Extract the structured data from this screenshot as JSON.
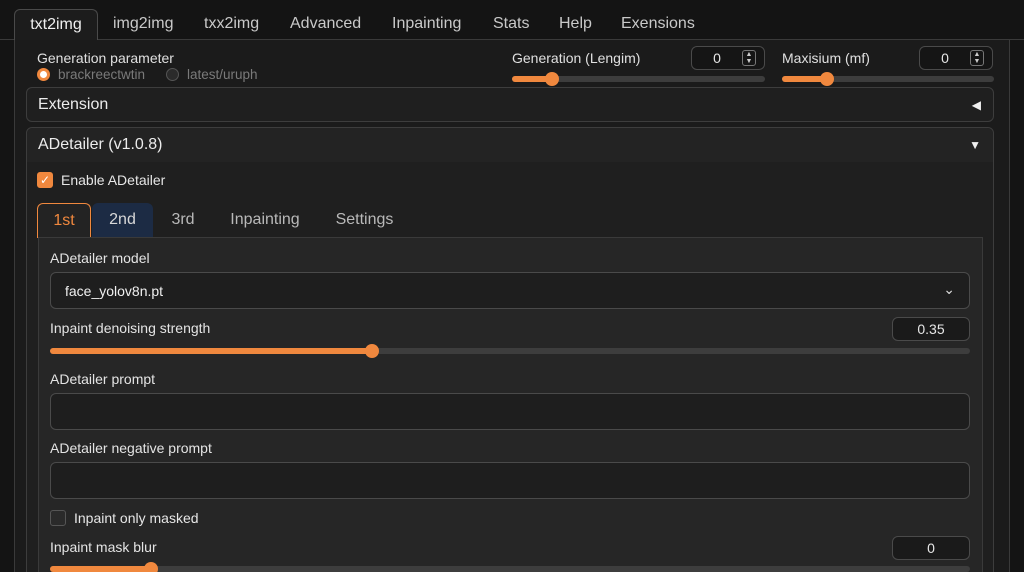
{
  "tabs": [
    {
      "label": "txt2img",
      "active": true
    },
    {
      "label": "img2img"
    },
    {
      "label": "txx2img"
    },
    {
      "label": "Advanced"
    },
    {
      "label": "Inpainting"
    },
    {
      "label": "Stats"
    },
    {
      "label": "Help"
    },
    {
      "label": "Exensions"
    }
  ],
  "generation": {
    "title": "Generation parameter",
    "radios": [
      {
        "label": "brackreectwtin",
        "selected": true
      },
      {
        "label": "latest/uruph",
        "selected": false
      }
    ],
    "length": {
      "label": "Generation (Lengim)",
      "value": "0",
      "slider_fraction": 0.16
    },
    "max": {
      "label": "Maxisium (mf)",
      "value": "0",
      "slider_fraction": 0.21
    }
  },
  "extension": {
    "title": "Extension",
    "collapsed": true
  },
  "adetailer": {
    "title": "ADetailer (v1.0.8)",
    "enable_label": "Enable ADetailer",
    "enabled": true,
    "subtabs": [
      "1st",
      "2nd",
      "3rd",
      "Inpainting",
      "Settings"
    ],
    "model_label": "ADetailer model",
    "model_value": "face_yolov8n.pt",
    "denoise_label": "Inpaint denoising strength",
    "denoise_value": "0.35",
    "denoise_fraction": 0.35,
    "prompt_label": "ADetailer prompt",
    "prompt_value": "",
    "neg_prompt_label": "ADetailer negative prompt",
    "neg_prompt_value": "",
    "only_masked_label": "Inpaint only masked",
    "only_masked": false,
    "mask_blur_label": "Inpaint mask blur",
    "mask_blur_value": "0",
    "mask_blur_fraction": 0.11
  },
  "colors": {
    "accent": "#f0883e",
    "background": "#141414",
    "panel": "#1b1b1b",
    "subtab_highlight": "#1c2b44"
  }
}
